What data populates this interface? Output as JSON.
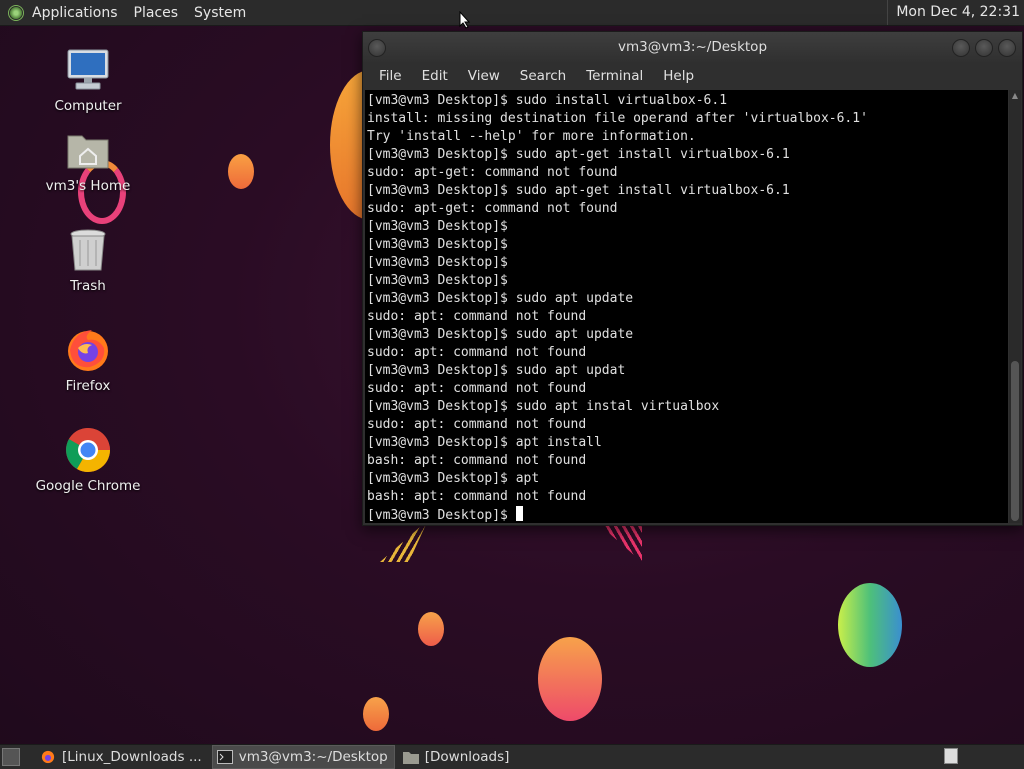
{
  "top_panel": {
    "menus": [
      "Applications",
      "Places",
      "System"
    ],
    "clock": "Mon Dec  4, 22:31"
  },
  "desktop_icons": [
    {
      "label": "Computer",
      "icon": "computer-icon"
    },
    {
      "label": "vm3's Home",
      "icon": "home-folder-icon"
    },
    {
      "label": "Trash",
      "icon": "trash-icon"
    },
    {
      "label": "Firefox",
      "icon": "firefox-icon"
    },
    {
      "label": "Google Chrome",
      "icon": "chrome-icon"
    }
  ],
  "terminal": {
    "title": "vm3@vm3:~/Desktop",
    "menu": [
      "File",
      "Edit",
      "View",
      "Search",
      "Terminal",
      "Help"
    ],
    "lines": [
      "[vm3@vm3 Desktop]$ sudo install virtualbox-6.1",
      "install: missing destination file operand after 'virtualbox-6.1'",
      "Try 'install --help' for more information.",
      "[vm3@vm3 Desktop]$ sudo apt-get install virtualbox-6.1",
      "sudo: apt-get: command not found",
      "[vm3@vm3 Desktop]$ sudo apt-get install virtualbox-6.1",
      "sudo: apt-get: command not found",
      "[vm3@vm3 Desktop]$",
      "[vm3@vm3 Desktop]$",
      "[vm3@vm3 Desktop]$",
      "[vm3@vm3 Desktop]$",
      "[vm3@vm3 Desktop]$ sudo apt update",
      "sudo: apt: command not found",
      "[vm3@vm3 Desktop]$ sudo apt update",
      "sudo: apt: command not found",
      "[vm3@vm3 Desktop]$ sudo apt updat",
      "sudo: apt: command not found",
      "[vm3@vm3 Desktop]$ sudo apt instal virtualbox",
      "sudo: apt: command not found",
      "[vm3@vm3 Desktop]$ apt install",
      "bash: apt: command not found",
      "[vm3@vm3 Desktop]$ apt",
      "bash: apt: command not found"
    ],
    "prompt": "[vm3@vm3 Desktop]$ "
  },
  "taskbar": {
    "tasks": [
      {
        "label": "[Linux_Downloads ...",
        "icon": "firefox-icon",
        "active": false
      },
      {
        "label": "vm3@vm3:~/Desktop",
        "icon": "terminal-icon",
        "active": true
      },
      {
        "label": "[Downloads]",
        "icon": "folder-icon",
        "active": false
      }
    ]
  }
}
